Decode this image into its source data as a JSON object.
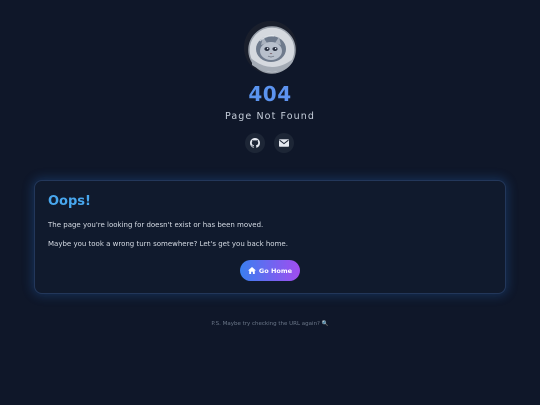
{
  "error": {
    "code": "404",
    "subtitle": "Page Not Found"
  },
  "socials": [
    {
      "icon": "github-icon"
    },
    {
      "icon": "mail-icon"
    }
  ],
  "card": {
    "title": "Oops!",
    "line1": "The page you're looking for doesn't exist or has been moved.",
    "line2": "Maybe you took a wrong turn somewhere? Let's get you back home.",
    "button_label": "Go Home",
    "button_icon": "home-icon"
  },
  "footer": {
    "note": "P.S. Maybe try checking the URL again? 🔍"
  },
  "colors": {
    "background": "#0f1729",
    "accent": "#48a7ee",
    "button_gradient_start": "#3a7ff0",
    "button_gradient_end": "#a14df0"
  }
}
